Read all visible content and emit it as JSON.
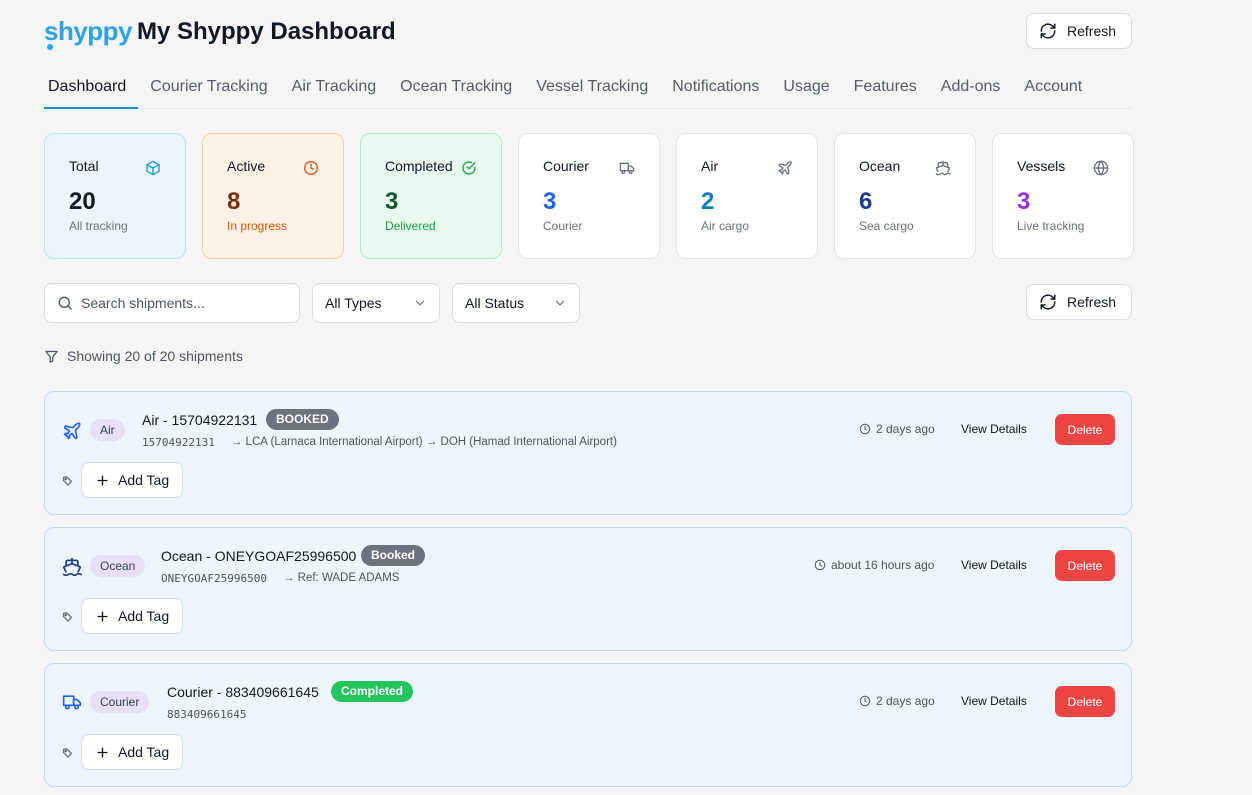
{
  "header": {
    "logo": "shyppy",
    "title": "My Shyppy Dashboard",
    "refresh_label": "Refresh"
  },
  "tabs": [
    {
      "label": "Dashboard",
      "active": true
    },
    {
      "label": "Courier Tracking"
    },
    {
      "label": "Air Tracking"
    },
    {
      "label": "Ocean Tracking"
    },
    {
      "label": "Vessel Tracking"
    },
    {
      "label": "Notifications"
    },
    {
      "label": "Usage"
    },
    {
      "label": "Features"
    },
    {
      "label": "Add-ons"
    },
    {
      "label": "Account"
    }
  ],
  "stats": [
    {
      "label": "Total",
      "value": "20",
      "sub": "All tracking",
      "icon": "cube-icon",
      "color": "#1b9ad6"
    },
    {
      "label": "Active",
      "value": "8",
      "sub": "In progress",
      "icon": "clock-icon",
      "color": "#e2561a"
    },
    {
      "label": "Completed",
      "value": "3",
      "sub": "Delivered",
      "icon": "check-circle-icon",
      "color": "#16a34a"
    },
    {
      "label": "Courier",
      "value": "3",
      "sub": "Courier",
      "icon": "truck-icon",
      "color": "#2563eb"
    },
    {
      "label": "Air",
      "value": "2",
      "sub": "Air cargo",
      "icon": "plane-icon",
      "color": "#0e7bbf"
    },
    {
      "label": "Ocean",
      "value": "6",
      "sub": "Sea cargo",
      "icon": "ship-icon",
      "color": "#1e3a8a"
    },
    {
      "label": "Vessels",
      "value": "3",
      "sub": "Live tracking",
      "icon": "globe-icon",
      "color": "#9333ea"
    }
  ],
  "filters": {
    "search_placeholder": "Search shipments...",
    "type_select": "All Types",
    "status_select": "All Status",
    "refresh_label": "Refresh"
  },
  "showing_text": "Showing 20 of 20 shipments",
  "shipments": [
    {
      "type": "Air",
      "title": "Air - 15704922131",
      "badge": "BOOKED",
      "badge_color": "#6b7280",
      "tracking_no": "15704922131",
      "route": "→ LCA (Larnaca International Airport) → DOH (Hamad International Airport)",
      "time": "2 days ago",
      "view_label": "View Details",
      "delete_label": "Delete",
      "add_tag_label": "Add Tag"
    },
    {
      "type": "Ocean",
      "title": "Ocean - ONEYGOAF25996500",
      "badge": "Booked",
      "badge_color": "#6b7280",
      "tracking_no": "ONEYGOAF25996500",
      "route": "→ Ref: WADE ADAMS",
      "time": "about 16 hours ago",
      "view_label": "View Details",
      "delete_label": "Delete",
      "add_tag_label": "Add Tag"
    },
    {
      "type": "Courier",
      "title": "Courier - 883409661645",
      "badge": "Completed",
      "badge_color": "#22c55e",
      "tracking_no": "883409661645",
      "route": "",
      "time": "2 days ago",
      "view_label": "View Details",
      "delete_label": "Delete",
      "add_tag_label": "Add Tag"
    }
  ]
}
